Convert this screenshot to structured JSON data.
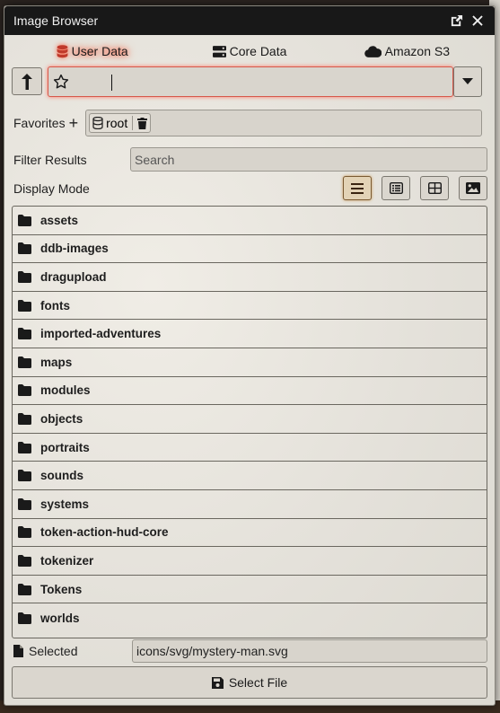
{
  "window": {
    "title": "Image Browser"
  },
  "tabs": [
    {
      "label": "User Data",
      "active": true,
      "icon": "database-icon"
    },
    {
      "label": "Core Data",
      "active": false,
      "icon": "server-icon"
    },
    {
      "label": "Amazon S3",
      "active": false,
      "icon": "cloud-icon"
    }
  ],
  "path": {
    "value": ""
  },
  "favorites": {
    "label": "Favorites",
    "items": [
      {
        "label": "root"
      }
    ]
  },
  "filter": {
    "label": "Filter Results",
    "placeholder": "Search"
  },
  "display_mode": {
    "label": "Display Mode",
    "active": "list"
  },
  "files": [
    "assets",
    "ddb-images",
    "dragupload",
    "fonts",
    "imported-adventures",
    "maps",
    "modules",
    "objects",
    "portraits",
    "sounds",
    "systems",
    "token-action-hud-core",
    "tokenizer",
    "Tokens",
    "worlds"
  ],
  "selected": {
    "label": "Selected",
    "value": "icons/svg/mystery-man.svg"
  },
  "select_button": {
    "label": "Select File"
  },
  "colors": {
    "active_tab_glow": "#ff5a3a",
    "titlebar": "#181818"
  }
}
